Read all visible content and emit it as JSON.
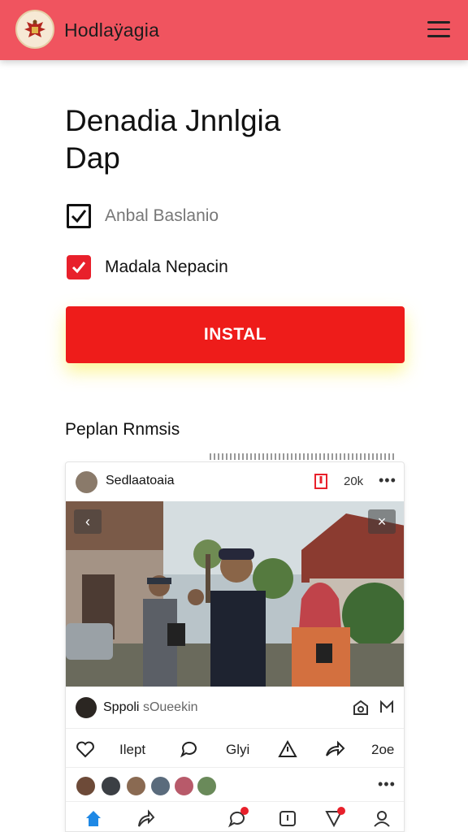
{
  "header": {
    "app_name": "Hodlaÿagia",
    "menu_icon": "hamburger-menu-icon",
    "logo_icon": "garuda-emblem-icon",
    "bar_color": "#f0545f"
  },
  "page": {
    "title_line1": "Denadia Jnnlgia",
    "title_line2": "Dap"
  },
  "options": [
    {
      "label": "Anbal Baslanio",
      "checked": true,
      "style": "outline"
    },
    {
      "label": "Madala Nepacin",
      "checked": true,
      "style": "red"
    }
  ],
  "install_button": {
    "label": "INSTAL",
    "color": "#ee1c1a"
  },
  "section": {
    "title": "Peplan Rnmsis"
  },
  "post": {
    "author": "Sedlaatoaia",
    "count": "20k",
    "commenter_name": "Sppoli",
    "commenter_sub": "sOueekin",
    "actions": {
      "like_label": "Ilept",
      "share_label": "Glyi",
      "count_label": "2oe"
    }
  }
}
